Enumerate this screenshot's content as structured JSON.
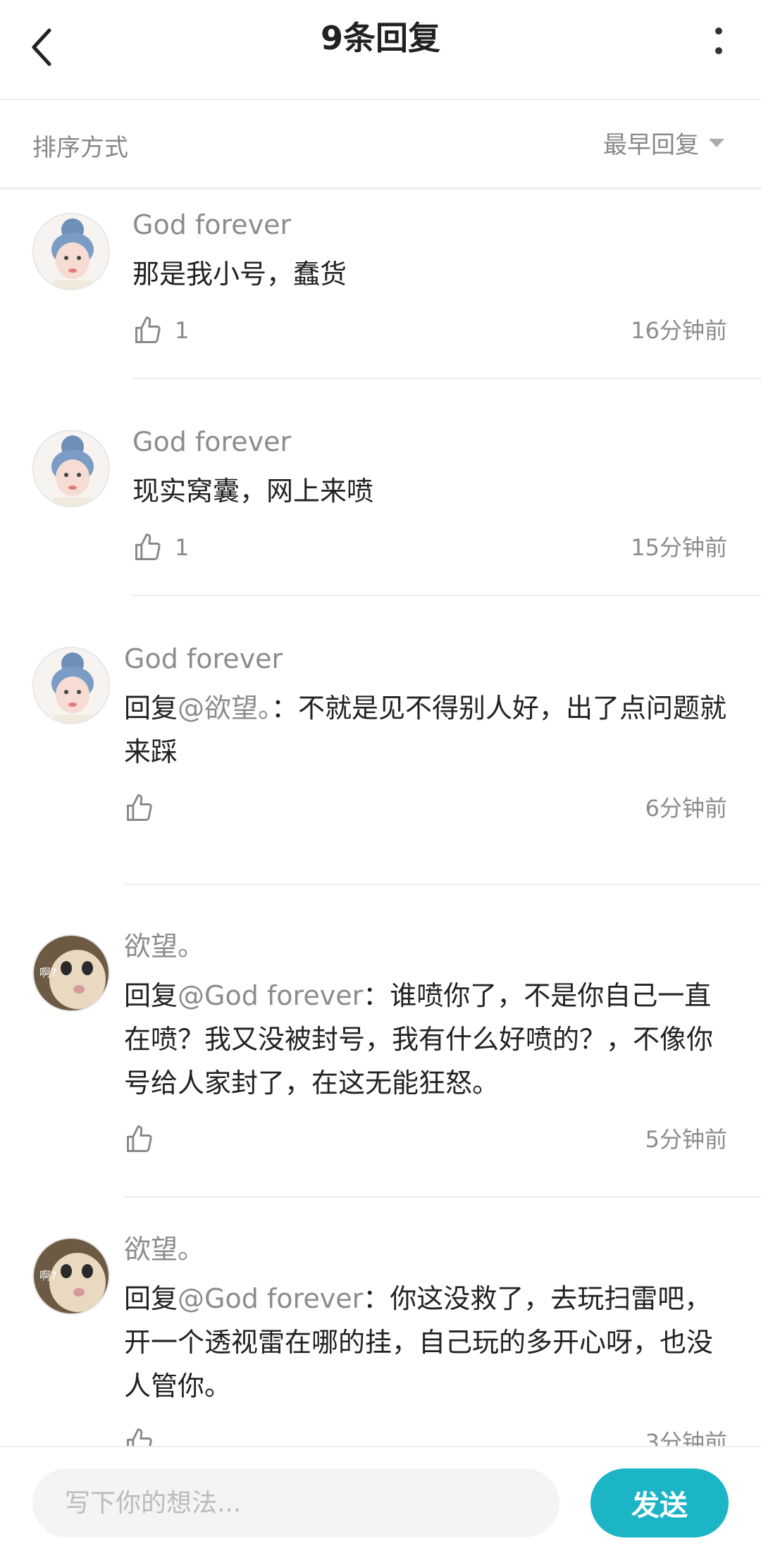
{
  "header": {
    "title": "9条回复",
    "back_icon": "chevron-left-icon",
    "more_icon": "vertical-dots-icon"
  },
  "sort": {
    "label": "排序方式",
    "selected": "最早回复"
  },
  "comments": [
    {
      "username": "God forever",
      "text": "那是我小号，蠢货",
      "reply_prefix": "",
      "mention": "",
      "mention_suffix": "",
      "likes": "1",
      "time": "16分钟前",
      "avatar": "girl-avatar"
    },
    {
      "username": "God forever",
      "text": "现实窝囊，网上来喷",
      "reply_prefix": "",
      "mention": "",
      "mention_suffix": "",
      "likes": "1",
      "time": "15分钟前",
      "avatar": "girl-avatar"
    },
    {
      "username": "God forever",
      "reply_prefix": "回复",
      "mention": "@欲望。",
      "mention_suffix": "：",
      "text": "不就是见不得别人好，出了点问题就来踩",
      "likes": "",
      "time": "6分钟前",
      "avatar": "girl-avatar"
    },
    {
      "username": "欲望。",
      "reply_prefix": "回复",
      "mention": "@God forever",
      "mention_suffix": "：",
      "text": "谁喷你了，不是你自己一直在喷？我又没被封号，我有什么好喷的？，不像你号给人家封了，在这无能狂怒。",
      "likes": "",
      "time": "5分钟前",
      "avatar": "cat-avatar",
      "avatar_caption": "啊?"
    },
    {
      "username": "欲望。",
      "reply_prefix": "回复",
      "mention": "@God forever",
      "mention_suffix": "：",
      "text": "你这没救了，去玩扫雷吧，开一个透视雷在哪的挂，自己玩的多开心呀，也没人管你。",
      "likes": "",
      "time": "3分钟前",
      "avatar": "cat-avatar",
      "avatar_caption": "啊?"
    }
  ],
  "composer": {
    "placeholder": "写下你的想法...",
    "send_label": "发送"
  },
  "colors": {
    "accent": "#1bb5c6",
    "muted": "#8c8c8c"
  }
}
